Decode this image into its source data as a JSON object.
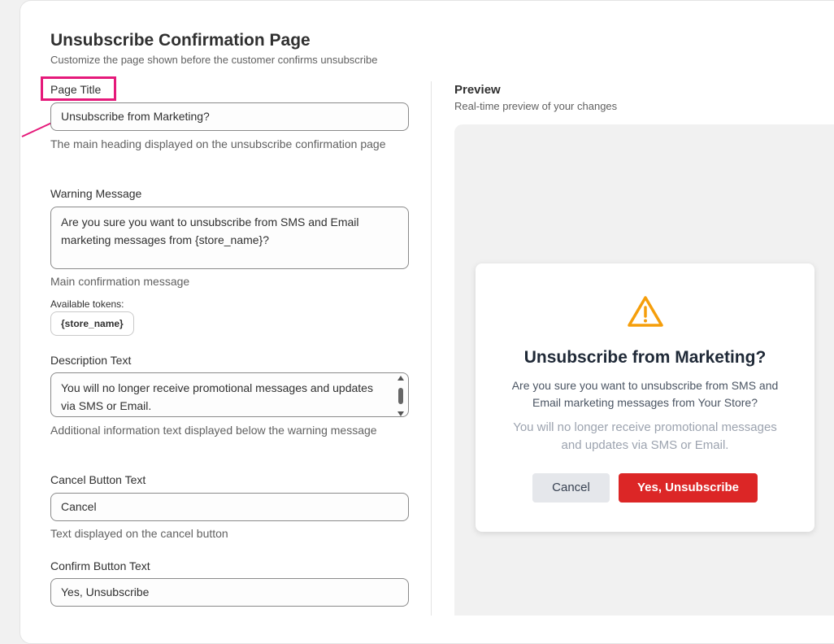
{
  "header": {
    "title": "Unsubscribe Confirmation Page",
    "subtitle": "Customize the page shown before the customer confirms unsubscribe"
  },
  "form": {
    "page_title": {
      "label": "Page Title",
      "value": "Unsubscribe from Marketing?",
      "help": "The main heading displayed on the unsubscribe confirmation page"
    },
    "warning_message": {
      "label": "Warning Message",
      "value": "Are you sure you want to unsubscribe from SMS and Email marketing messages from {store_name}?",
      "help": "Main confirmation message",
      "tokens_label": "Available tokens:",
      "tokens": [
        "{store_name}"
      ]
    },
    "description_text": {
      "label": "Description Text",
      "value": "You will no longer receive promotional messages and updates via SMS or Email.",
      "help": "Additional information text displayed below the warning message"
    },
    "cancel_button_text": {
      "label": "Cancel Button Text",
      "value": "Cancel",
      "help": "Text displayed on the cancel button"
    },
    "confirm_button_text": {
      "label": "Confirm Button Text",
      "value": "Yes, Unsubscribe"
    }
  },
  "preview": {
    "title": "Preview",
    "subtitle": "Real-time preview of your changes",
    "modal": {
      "icon": "warning-triangle-icon",
      "heading": "Unsubscribe from Marketing?",
      "warning": "Are you sure you want to unsubscribe from SMS and Email marketing messages from Your Store?",
      "description": "You will no longer receive promotional messages and updates via SMS or Email.",
      "cancel_label": "Cancel",
      "confirm_label": "Yes, Unsubscribe"
    }
  },
  "colors": {
    "annotation": "#e5197a",
    "confirm_button": "#dc2626",
    "warning_icon": "#f59e0b"
  }
}
